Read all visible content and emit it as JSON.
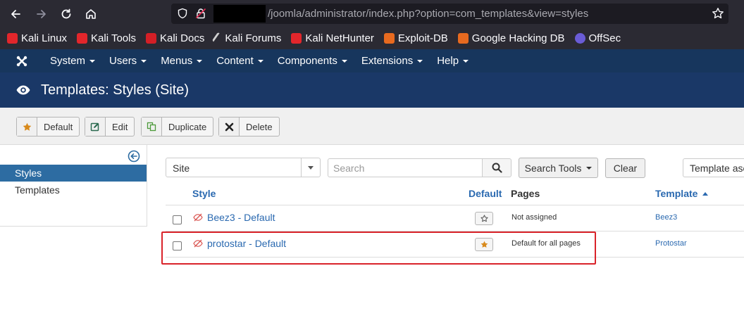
{
  "browser": {
    "url": "/joomla/administrator/index.php?option=com_templates&view=styles",
    "bookmarks": [
      {
        "label": "Kali Linux",
        "icon": "kali-dragon-icon",
        "color": "#e3262b"
      },
      {
        "label": "Kali Tools",
        "icon": "kali-dragon-icon",
        "color": "#e3262b"
      },
      {
        "label": "Kali Docs",
        "icon": "kali-docs-icon",
        "color": "#d41f26"
      },
      {
        "label": "Kali Forums",
        "icon": "kali-forums-icon",
        "color": "#cfcfcf"
      },
      {
        "label": "Kali NetHunter",
        "icon": "kali-dragon-icon",
        "color": "#e3262b"
      },
      {
        "label": "Exploit-DB",
        "icon": "exploit-db-icon",
        "color": "#e86a1f"
      },
      {
        "label": "Google Hacking DB",
        "icon": "ghdb-icon",
        "color": "#e86a1f"
      },
      {
        "label": "OffSec",
        "icon": "offsec-icon",
        "color": "#6a5cd6"
      }
    ]
  },
  "nav": {
    "menus": [
      "System",
      "Users",
      "Menus",
      "Content",
      "Components",
      "Extensions",
      "Help"
    ]
  },
  "header": {
    "title": "Templates: Styles (Site)"
  },
  "toolbar": {
    "default_label": "Default",
    "edit_label": "Edit",
    "duplicate_label": "Duplicate",
    "delete_label": "Delete"
  },
  "sidebar": {
    "items": [
      {
        "label": "Styles",
        "active": true
      },
      {
        "label": "Templates",
        "active": false
      }
    ]
  },
  "filters": {
    "client_value": "Site",
    "search_placeholder": "Search",
    "search_tools_label": "Search Tools",
    "clear_label": "Clear",
    "sort_value": "Template asc"
  },
  "table": {
    "headers": {
      "style": "Style",
      "default": "Default",
      "pages": "Pages",
      "template": "Template"
    },
    "rows": [
      {
        "style": "Beez3 - Default",
        "is_default": false,
        "pages": "Not assigned",
        "template": "Beez3"
      },
      {
        "style": "protostar - Default",
        "is_default": true,
        "pages": "Default for all pages",
        "template": "Protostar"
      }
    ]
  },
  "colors": {
    "nav_bg": "#17365d",
    "header_bg": "#1a3867",
    "link": "#2a69b0",
    "star": "#d88a1c",
    "highlight": "#d9232a"
  }
}
